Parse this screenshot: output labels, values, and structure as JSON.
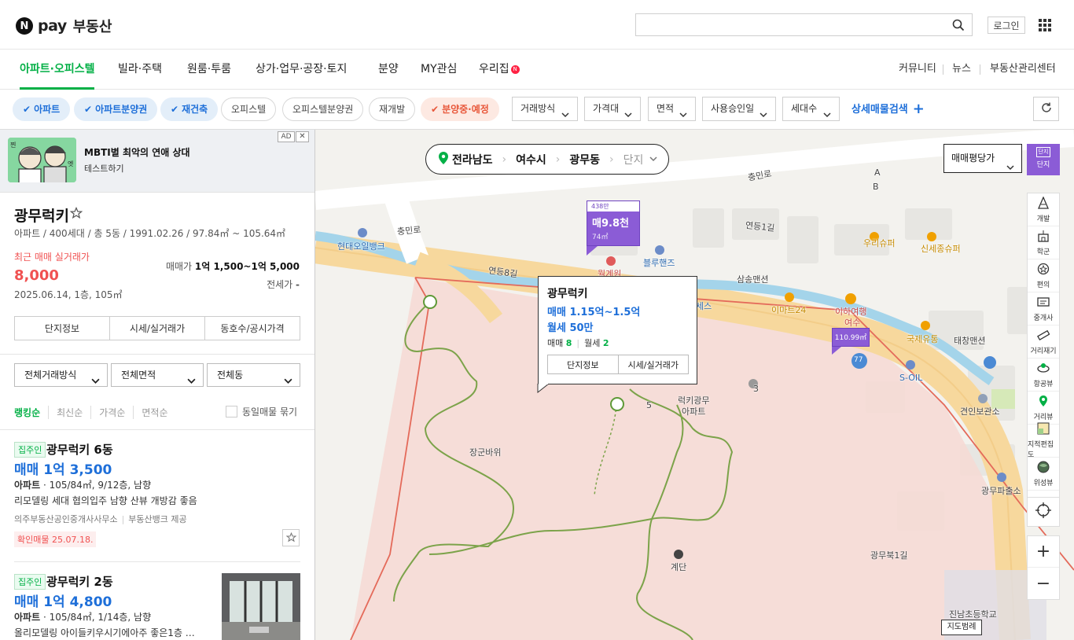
{
  "header": {
    "logo_n": "N",
    "logo_pay": "pay",
    "brand": "부동산",
    "search_placeholder": "",
    "login": "로그인"
  },
  "nav": {
    "items": [
      "아파트·오피스텔",
      "빌라·주택",
      "원룸·투룸",
      "상가·업무·공장·토지",
      "분양",
      "MY관심",
      "우리집"
    ],
    "badge": "N",
    "right": [
      "커뮤니티",
      "뉴스",
      "부동산관리센터"
    ]
  },
  "filters": {
    "chips": [
      "아파트",
      "아파트분양권",
      "재건축",
      "오피스텔",
      "오피스텔분양권",
      "재개발",
      "분양중·예정"
    ],
    "dropdowns": [
      "거래방식",
      "가격대",
      "면적",
      "사용승인일",
      "세대수"
    ],
    "advanced": "상세매물검색"
  },
  "ad": {
    "tag": "AD",
    "close": "✕",
    "title": "MBTI별 최악의 연애 상대",
    "subtitle": "테스트하기",
    "img_text_1": "찐",
    "img_text_2": "엣"
  },
  "complex": {
    "name": "광무럭키",
    "summary": "아파트 / 400세대 / 총 5동 / 1991.02.26 / 97.84㎡ ~ 105.64㎡",
    "recent_label": "최근 매매 실거래가",
    "recent_price": "8,000",
    "recent_date": "2025.06.14, 1층, 105㎡",
    "sale_label": "매매가",
    "sale_value": "1억 1,500~1억 5,000",
    "jeonse_label": "전세가",
    "jeonse_value": "-",
    "buttons": [
      "단지정보",
      "시세/실거래가",
      "동호수/공시가격"
    ]
  },
  "list_filters": {
    "dropdowns": [
      "전체거래방식",
      "전체면적",
      "전체동"
    ],
    "sorts": [
      "랭킹순",
      "최신순",
      "가격순",
      "면적순"
    ],
    "group_label": "동일매물 묶기"
  },
  "listings": [
    {
      "badge": "집주인",
      "name": "광무럭키 6동",
      "price": "매매 1억 3,500",
      "type": "아파트",
      "spec": " · 105/84㎡, 9/12층, 남향",
      "desc": "리모델링 세대 협의입주 남향 산뷰 개방감 좋음",
      "agent": "의주부동산공인중개사사무소",
      "provider": "부동산뱅크 제공",
      "verified": "확인매물 25.07.18."
    },
    {
      "badge": "집주인",
      "name": "광무럭키 2동",
      "price": "매매 1억 4,800",
      "type": "아파트",
      "spec": " · 105/84㎡, 1/14층, 남향",
      "desc": "올리모델링 아이들키우시기에아주 좋은1층 …"
    }
  ],
  "map": {
    "breadcrumb": [
      "전라남도",
      "여수시",
      "광무동",
      "단지"
    ],
    "map_type": "매매평당가",
    "complex_toggle": [
      "단지",
      "단지"
    ],
    "tools": [
      "개발",
      "학군",
      "편의",
      "중개사",
      "거리재기",
      "항공뷰",
      "거리뷰",
      "지적편집도",
      "위성뷰"
    ],
    "zoom_in": "+",
    "zoom_out": "−",
    "scale": "지도범례",
    "marker1": {
      "top": "438만",
      "main": "매9.8천",
      "sub": "74㎡"
    },
    "marker2": {
      "main": "110.99㎡"
    },
    "popup": {
      "title": "광무럭키",
      "sale": "매매 1.15억~1.5억",
      "rent": "월세 50만",
      "sale_count_label": "매매",
      "sale_count": "8",
      "rent_count_label": "월세",
      "rent_count": "2",
      "buttons": [
        "단지정보",
        "시세/실거래가"
      ]
    },
    "labels": {
      "hyundai": "현대오일뱅크",
      "chungmin": "충민로",
      "chungmin2": "충민로",
      "yeondeung8": "연등8길",
      "yeondeung1": "연등1길",
      "bluehands": "블루핸즈",
      "samsong": "삼송맨션",
      "woori": "우리슈퍼",
      "sinse": "신세종슈퍼",
      "emart": "이마트24",
      "ihayeo": "이하여행",
      "yeosu": "여수",
      "gukje": "국제유통",
      "taechang": "태창맨션",
      "soil": "S-OIL",
      "gyeonin": "견인보관소",
      "luckykm": "럭키광무",
      "apt": "아파트",
      "janggun": "장군바위",
      "gyedan": "계단",
      "gwangmu_pol": "광무파출소",
      "gwangmubuk": "광무북1길",
      "jinnam": "진남초등학교",
      "road77": "77",
      "bldg5": "5",
      "bldg3": "3",
      "wolgye": "월계원",
      "ceses": "세스",
      "A": "A",
      "B": "B"
    }
  }
}
